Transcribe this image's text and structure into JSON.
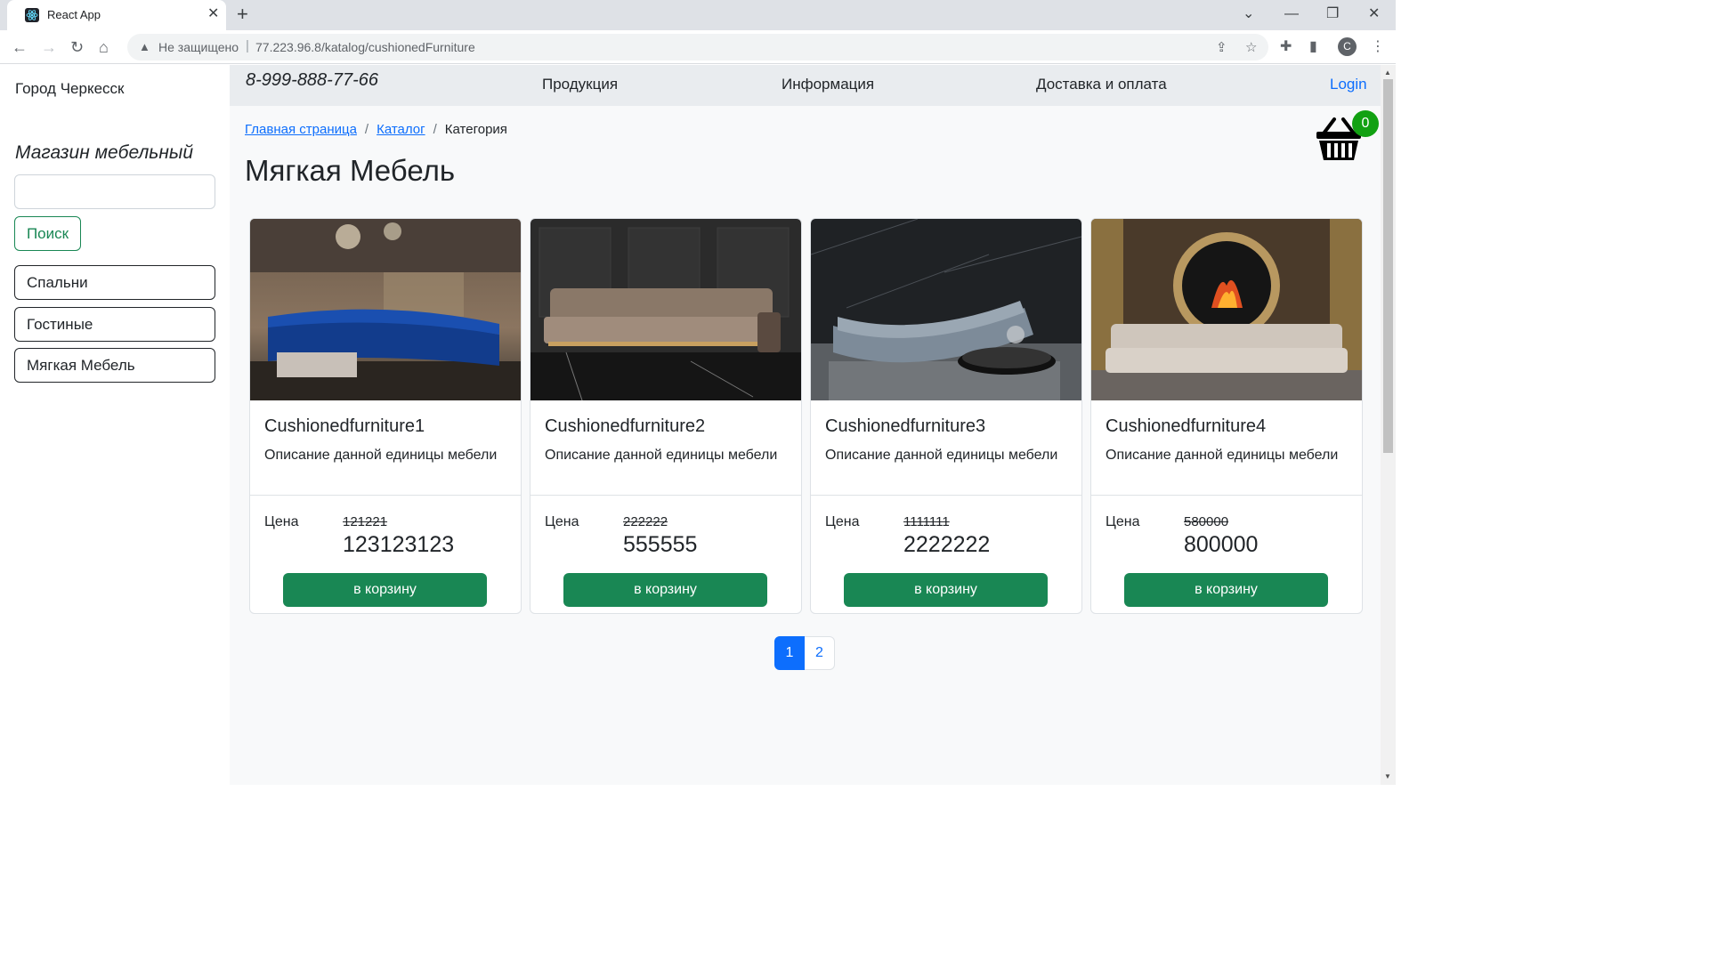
{
  "browser": {
    "tab_title": "React App",
    "tab_close": "✕",
    "new_tab": "+",
    "insecure_label": "Не защищено",
    "url": "77.223.96.8/katalog/cushionedFurniture",
    "profile_initial": "C"
  },
  "sidebar": {
    "city": "Город Черкесск",
    "shop_title": "Магазин мебельный",
    "search_value": "",
    "search_button": "Поиск",
    "categories": [
      "Спальни",
      "Гостиные",
      "Мягкая Мебель"
    ]
  },
  "topnav": {
    "phone": "8-999-888-77-66",
    "links": [
      "Продукция",
      "Информация",
      "Доставка и оплата"
    ],
    "login": "Login"
  },
  "breadcrumb": {
    "home": "Главная страница",
    "catalog": "Каталог",
    "current": "Категория"
  },
  "page_title": "Мягкая Мебель",
  "cart": {
    "count": "0",
    "icon": "basket-icon",
    "badge_color": "#12a112"
  },
  "products": [
    {
      "name": "Cushionedfurniture1",
      "description": "Описание данной единицы мебели",
      "price_label": "Цена",
      "old_price": "121221",
      "price": "123123123",
      "button": "в корзину"
    },
    {
      "name": "Cushionedfurniture2",
      "description": "Описание данной единицы мебели",
      "price_label": "Цена",
      "old_price": "222222",
      "price": "555555",
      "button": "в корзину"
    },
    {
      "name": "Cushionedfurniture3",
      "description": "Описание данной единицы мебели",
      "price_label": "Цена",
      "old_price": "1111111",
      "price": "2222222",
      "button": "в корзину"
    },
    {
      "name": "Cushionedfurniture4",
      "description": "Описание данной единицы мебели",
      "price_label": "Цена",
      "old_price": "580000",
      "price": "800000",
      "button": "в корзину"
    }
  ],
  "pagination": {
    "pages": [
      "1",
      "2"
    ],
    "active": "1"
  },
  "colors": {
    "accent_green": "#198754",
    "link_blue": "#0d6efd"
  }
}
